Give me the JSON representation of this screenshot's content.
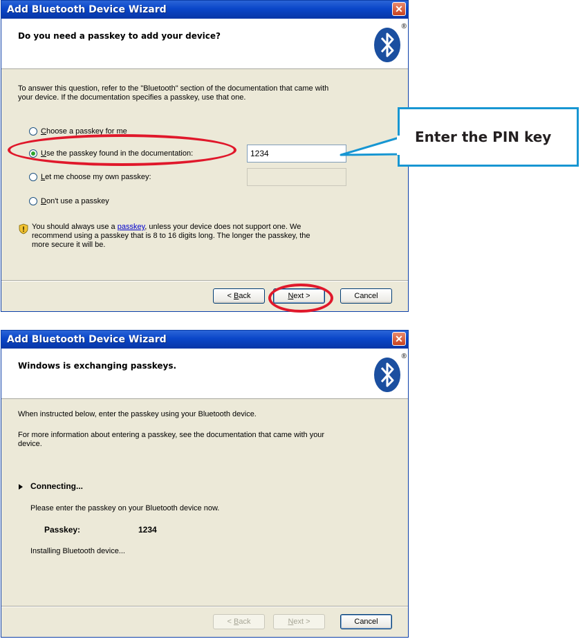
{
  "wizard1": {
    "title": "Add Bluetooth Device Wizard",
    "close_glyph": "✕",
    "heading": "Do you need a passkey to add your device?",
    "trademark": "®",
    "intro_line1": "To answer this question, refer to the \"Bluetooth\" section of the documentation that came with",
    "intro_line2": "your device. If the documentation specifies a passkey, use that one.",
    "options": [
      {
        "accel": "C",
        "rest": "hoose a passkey for me",
        "selected": false
      },
      {
        "accel": "U",
        "rest": "se the passkey found in the documentation:",
        "selected": true
      },
      {
        "accel": "L",
        "rest": "et me choose my own passkey:",
        "selected": false
      },
      {
        "accel": "D",
        "rest": "on't use a passkey",
        "selected": false
      }
    ],
    "doc_passkey_value": "1234",
    "own_passkey_value": "",
    "tip_before": "You should always use a ",
    "tip_link": "passkey",
    "tip_after": ", unless your device does not support one. We",
    "tip_line2": "recommend using a passkey that is 8 to 16 digits long. The longer the passkey, the",
    "tip_line3": "more secure it will be.",
    "back": {
      "pre": "< ",
      "accel": "B",
      "rest": "ack"
    },
    "next": {
      "accel": "N",
      "rest": "ext >"
    },
    "cancel": "Cancel"
  },
  "callout": {
    "text": "Enter the PIN key",
    "border_color": "#1796d2"
  },
  "highlight_color": "#e0182b",
  "wizard2": {
    "title": "Add Bluetooth Device Wizard",
    "close_glyph": "✕",
    "heading": "Windows is exchanging passkeys.",
    "trademark": "®",
    "line1": "When instructed below, enter the passkey using your Bluetooth device.",
    "line2a": "For more information about entering a passkey, see the documentation that came with your",
    "line2b": "device.",
    "status": "Connecting...",
    "instruction": "Please enter the passkey on your Bluetooth device now.",
    "passkey_label": "Passkey:",
    "passkey_value": "1234",
    "installing": "Installing Bluetooth device...",
    "back": {
      "pre": "< ",
      "accel": "B",
      "rest": "ack"
    },
    "next": {
      "accel": "N",
      "rest": "ext >"
    },
    "cancel": "Cancel"
  }
}
